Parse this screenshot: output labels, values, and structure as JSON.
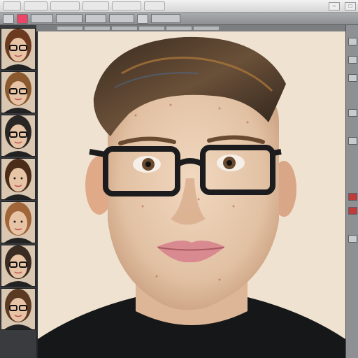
{
  "menubar": {
    "items": [
      "",
      "",
      "",
      "",
      "",
      ""
    ]
  },
  "filmstrip": {
    "thumbnails": [
      {
        "index": 1,
        "hair": "#6b3a1f",
        "glasses": true
      },
      {
        "index": 2,
        "hair": "#8a5a2e",
        "glasses": true
      },
      {
        "index": 3,
        "hair": "#2a2624",
        "glasses": true
      },
      {
        "index": 4,
        "hair": "#4a2c18",
        "glasses": false
      },
      {
        "index": 5,
        "hair": "#a0663a",
        "glasses": false
      },
      {
        "index": 6,
        "hair": "#3a2c22",
        "glasses": true
      },
      {
        "index": 7,
        "hair": "#5a3a22",
        "glasses": true
      }
    ]
  },
  "colors": {
    "canvas_bg": "#efe2d1",
    "skin": "#e9cdb3",
    "hair": "#5b4634",
    "glasses": "#1c1c1e",
    "shirt": "#161718",
    "accent": "#e44"
  }
}
